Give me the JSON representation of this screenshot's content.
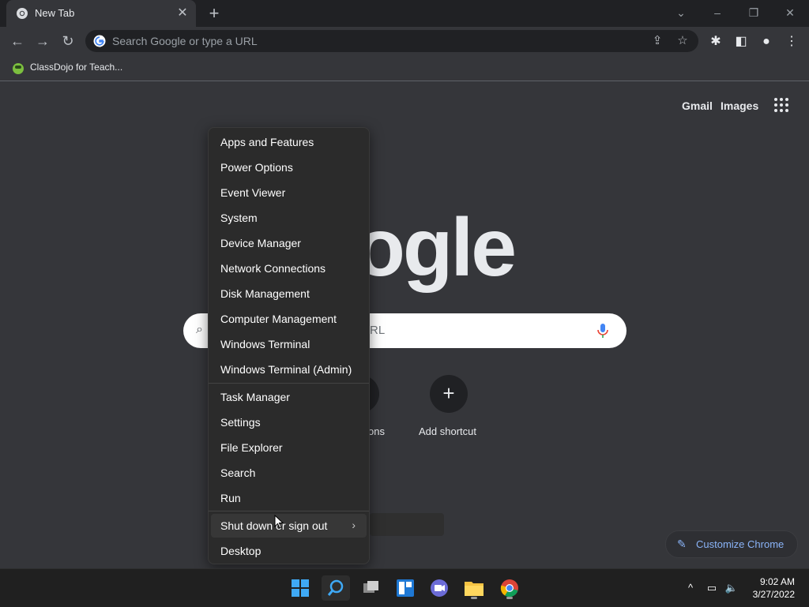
{
  "browser": {
    "tab_title": "New Tab",
    "omnibox_placeholder": "Search Google or type a URL",
    "bookmark_label": "ClassDojo for Teach..."
  },
  "ntp": {
    "gmail": "Gmail",
    "images": "Images",
    "logo_text": "oogle",
    "search_placeholder": "RL",
    "shortcut_partial_label": "ons",
    "add_shortcut_label": "Add shortcut",
    "customize_label": "Customize Chrome"
  },
  "menu": {
    "items_group1": [
      "Apps and Features",
      "Power Options",
      "Event Viewer",
      "System",
      "Device Manager",
      "Network Connections",
      "Disk Management",
      "Computer Management",
      "Windows Terminal",
      "Windows Terminal (Admin)"
    ],
    "items_group2": [
      "Task Manager",
      "Settings",
      "File Explorer",
      "Search",
      "Run"
    ],
    "shutdown": "Shut down or sign out",
    "desktop": "Desktop"
  },
  "taskbar": {
    "time": "9:02 AM",
    "date": "3/27/2022"
  },
  "colors": {
    "accent_blue": "#8ab4f8",
    "background": "#35363a"
  }
}
